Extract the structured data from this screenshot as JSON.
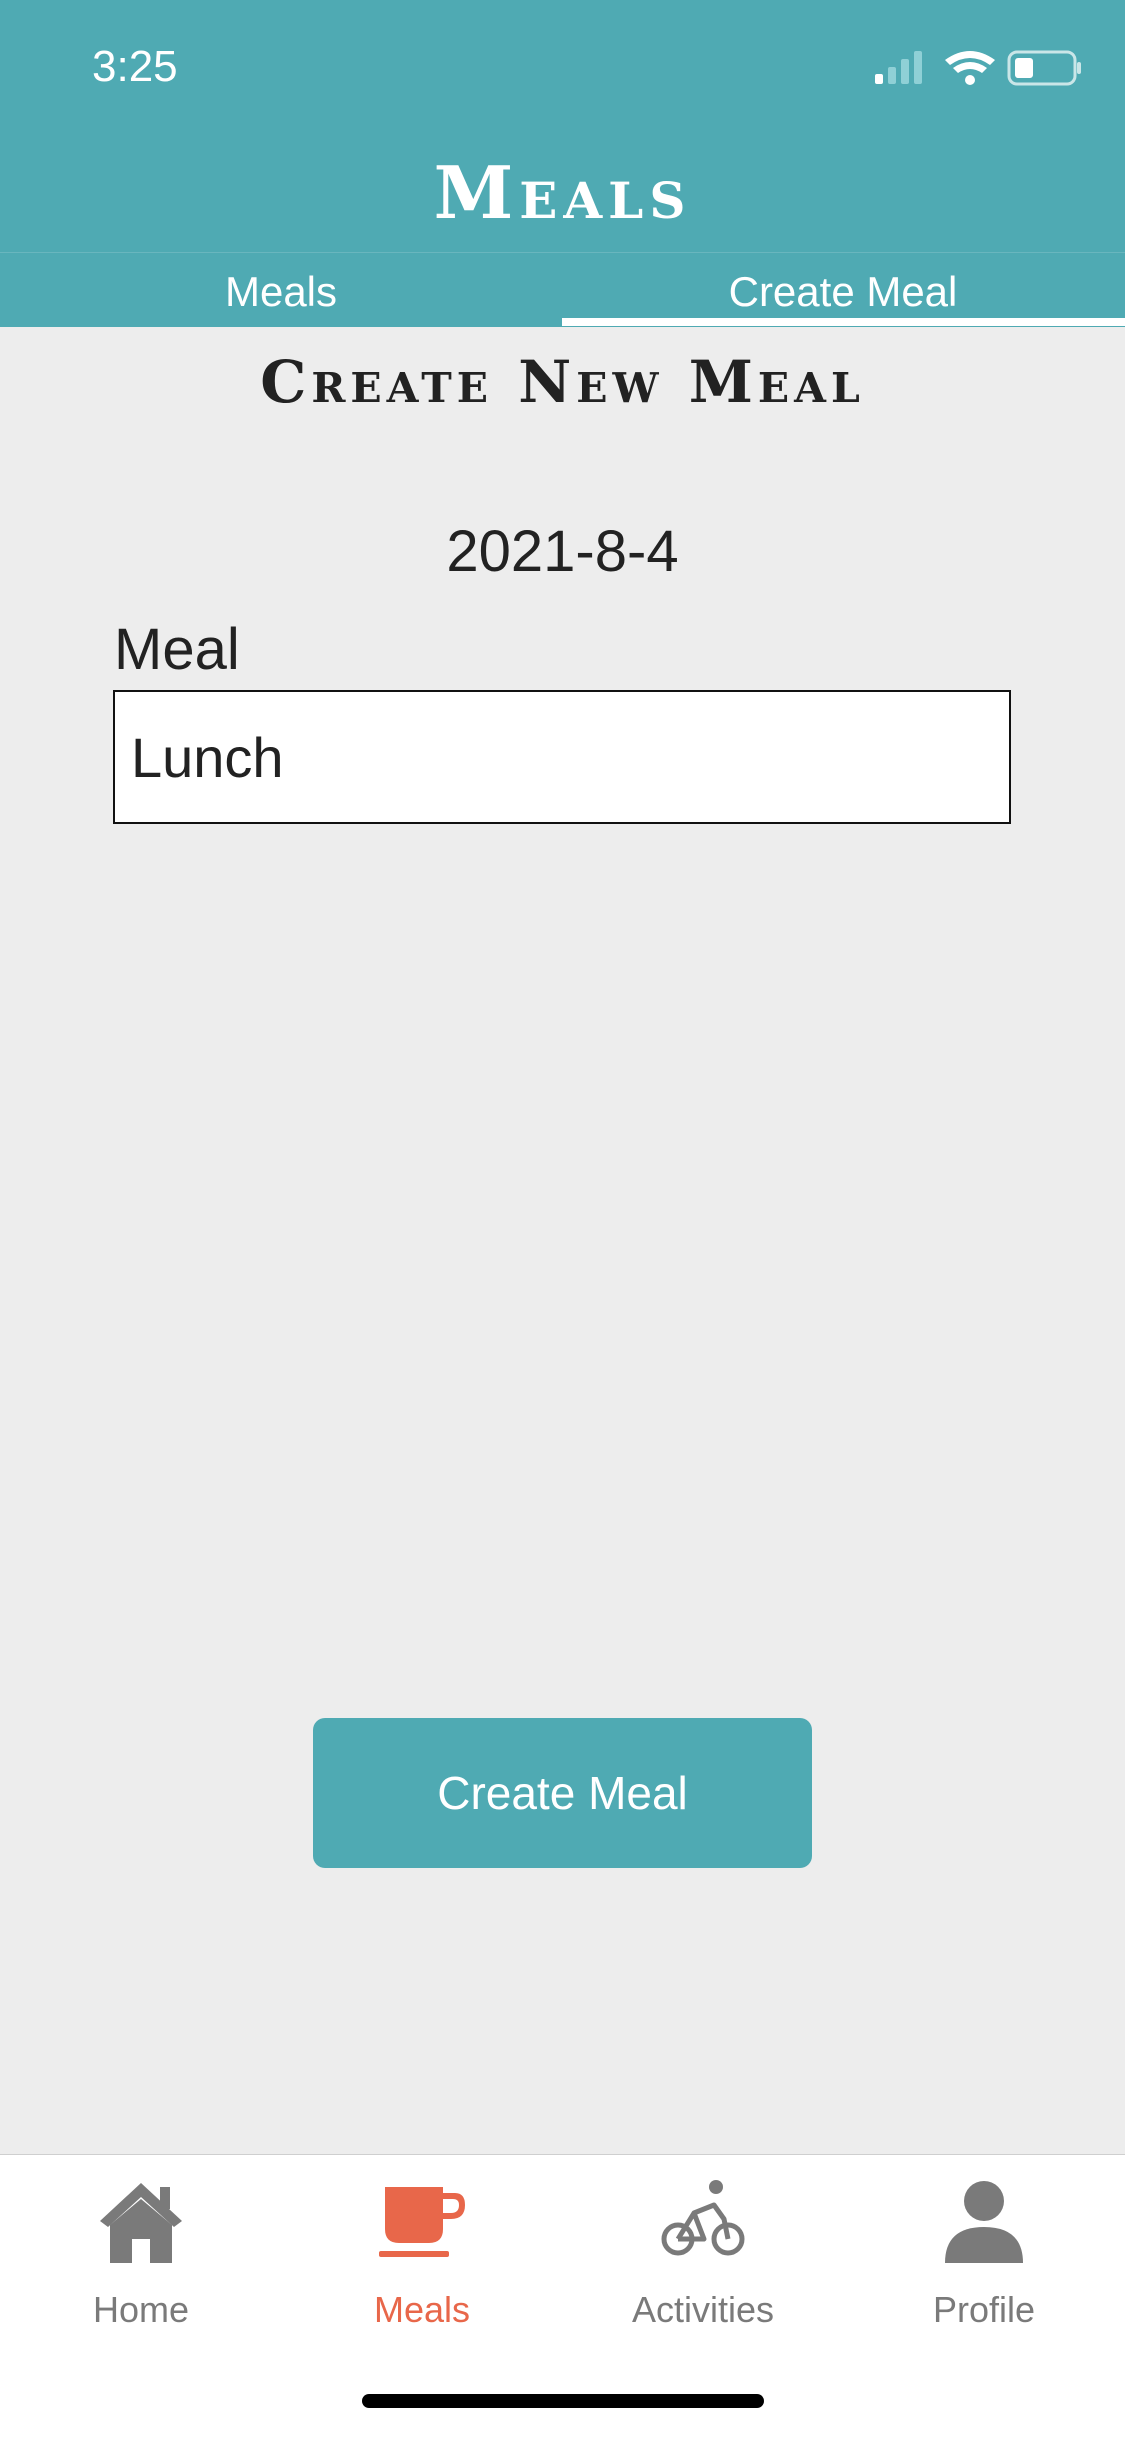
{
  "status_bar": {
    "time": "3:25"
  },
  "header": {
    "title": "Meals"
  },
  "tabs": [
    {
      "label": "Meals",
      "active": false
    },
    {
      "label": "Create Meal",
      "active": true
    }
  ],
  "form": {
    "heading": "Create New Meal",
    "date": "2021-8-4",
    "meal_label": "Meal",
    "meal_value": "Lunch",
    "submit_label": "Create Meal"
  },
  "bottom_nav": [
    {
      "label": "Home",
      "icon": "home-icon",
      "active": false
    },
    {
      "label": "Meals",
      "icon": "cup-icon",
      "active": true
    },
    {
      "label": "Activities",
      "icon": "bicycle-icon",
      "active": false
    },
    {
      "label": "Profile",
      "icon": "person-icon",
      "active": false
    }
  ],
  "colors": {
    "primary": "#4faab3",
    "accent": "#e8674a",
    "inactive": "#7a7a7a",
    "background": "#ededed"
  }
}
